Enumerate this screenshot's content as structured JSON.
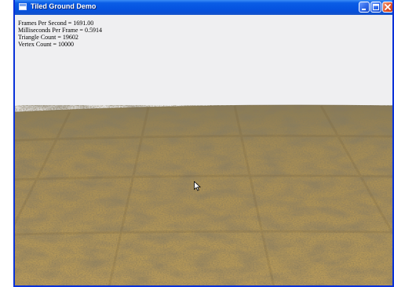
{
  "window": {
    "title": "Tiled Ground Demo",
    "icon": "app-window-icon",
    "controls": {
      "minimize": "minimize-icon",
      "maximize": "maximize-icon",
      "close": "close-icon"
    }
  },
  "hud": {
    "fps": "Frames Per Second = 1691.00",
    "ms_per_frame": "Milliseconds Per Frame = 0.5914",
    "triangle_count": "Triangle Count = 19602",
    "vertex_count": "Vertex Count = 10000"
  },
  "colors": {
    "titlebar": "#0553e0",
    "sky": "#efeff1",
    "ground_light": "#b89a5a",
    "ground_dark": "#5a4a2a"
  }
}
